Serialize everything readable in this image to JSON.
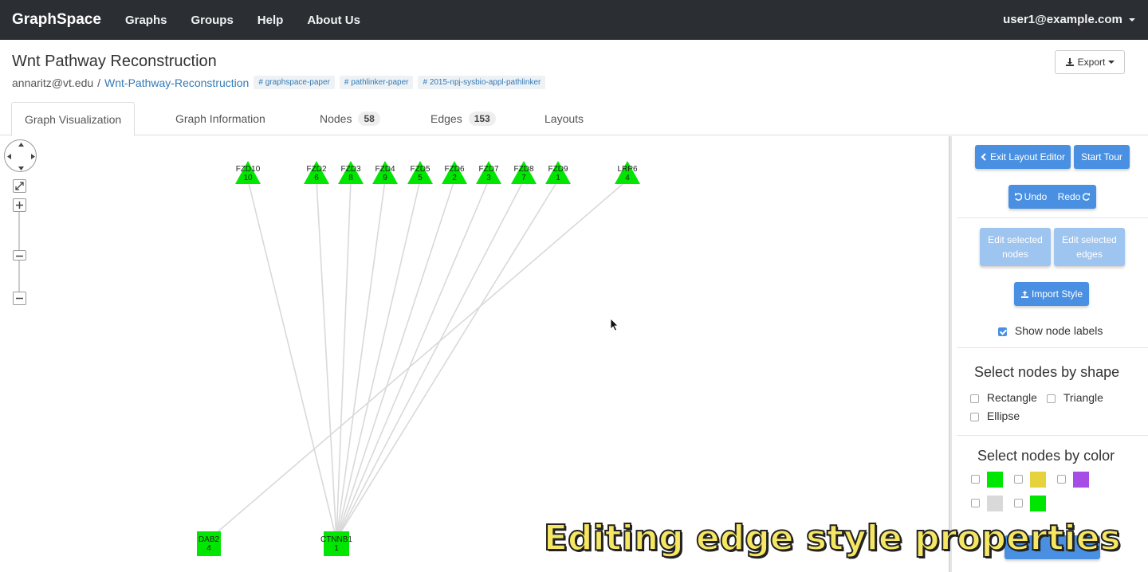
{
  "navbar": {
    "brand": "GraphSpace",
    "links": [
      "Graphs",
      "Groups",
      "Help",
      "About Us"
    ],
    "user": "user1@example.com"
  },
  "header": {
    "title": "Wnt Pathway Reconstruction",
    "owner": "annaritz@vt.edu",
    "separator": "/",
    "graph_link": "Wnt-Pathway-Reconstruction",
    "tags": [
      "graphspace-paper",
      "pathlinker-paper",
      "2015-npj-sysbio-appl-pathlinker"
    ],
    "export_label": "Export"
  },
  "tabs": [
    {
      "label": "Graph Visualization"
    },
    {
      "label": "Graph Information"
    },
    {
      "label": "Nodes",
      "count": "58"
    },
    {
      "label": "Edges",
      "count": "153"
    },
    {
      "label": "Layouts"
    }
  ],
  "graph": {
    "nodes_top": [
      {
        "name": "FZD10",
        "num": "10"
      },
      {
        "name": "FZD2",
        "num": "6"
      },
      {
        "name": "FZD3",
        "num": "8"
      },
      {
        "name": "FZD4",
        "num": "9"
      },
      {
        "name": "FZD5",
        "num": "5"
      },
      {
        "name": "FZD6",
        "num": "2"
      },
      {
        "name": "FZD7",
        "num": "3"
      },
      {
        "name": "FZD8",
        "num": "7"
      },
      {
        "name": "FZD9",
        "num": "1"
      },
      {
        "name": "LRP6",
        "num": "4"
      }
    ],
    "nodes_bottom": [
      {
        "name": "DAB2",
        "num": "4"
      },
      {
        "name": "CTNNB1",
        "num": "1"
      }
    ],
    "node_color": "#00e600",
    "edge_color": "#d9d9d9"
  },
  "sidebar": {
    "exit_layout_editor": "Exit Layout Editor",
    "start_tour": "Start Tour",
    "undo": "Undo",
    "redo": "Redo",
    "edit_nodes_line1": "Edit selected",
    "edit_nodes_line2": "nodes",
    "edit_edges_line1": "Edit selected",
    "edit_edges_line2": "edges",
    "import_style": "Import Style",
    "show_node_labels": "Show node labels",
    "select_by_shape_title": "Select nodes by shape",
    "shapes": [
      "Rectangle",
      "Triangle",
      "Ellipse"
    ],
    "select_by_color_title": "Select nodes by color",
    "swatch_colors": [
      "#00e600",
      "#e6d23c",
      "#a64de6",
      "#d9d9d9",
      "#00e600"
    ]
  },
  "caption": "Editing edge style properties"
}
